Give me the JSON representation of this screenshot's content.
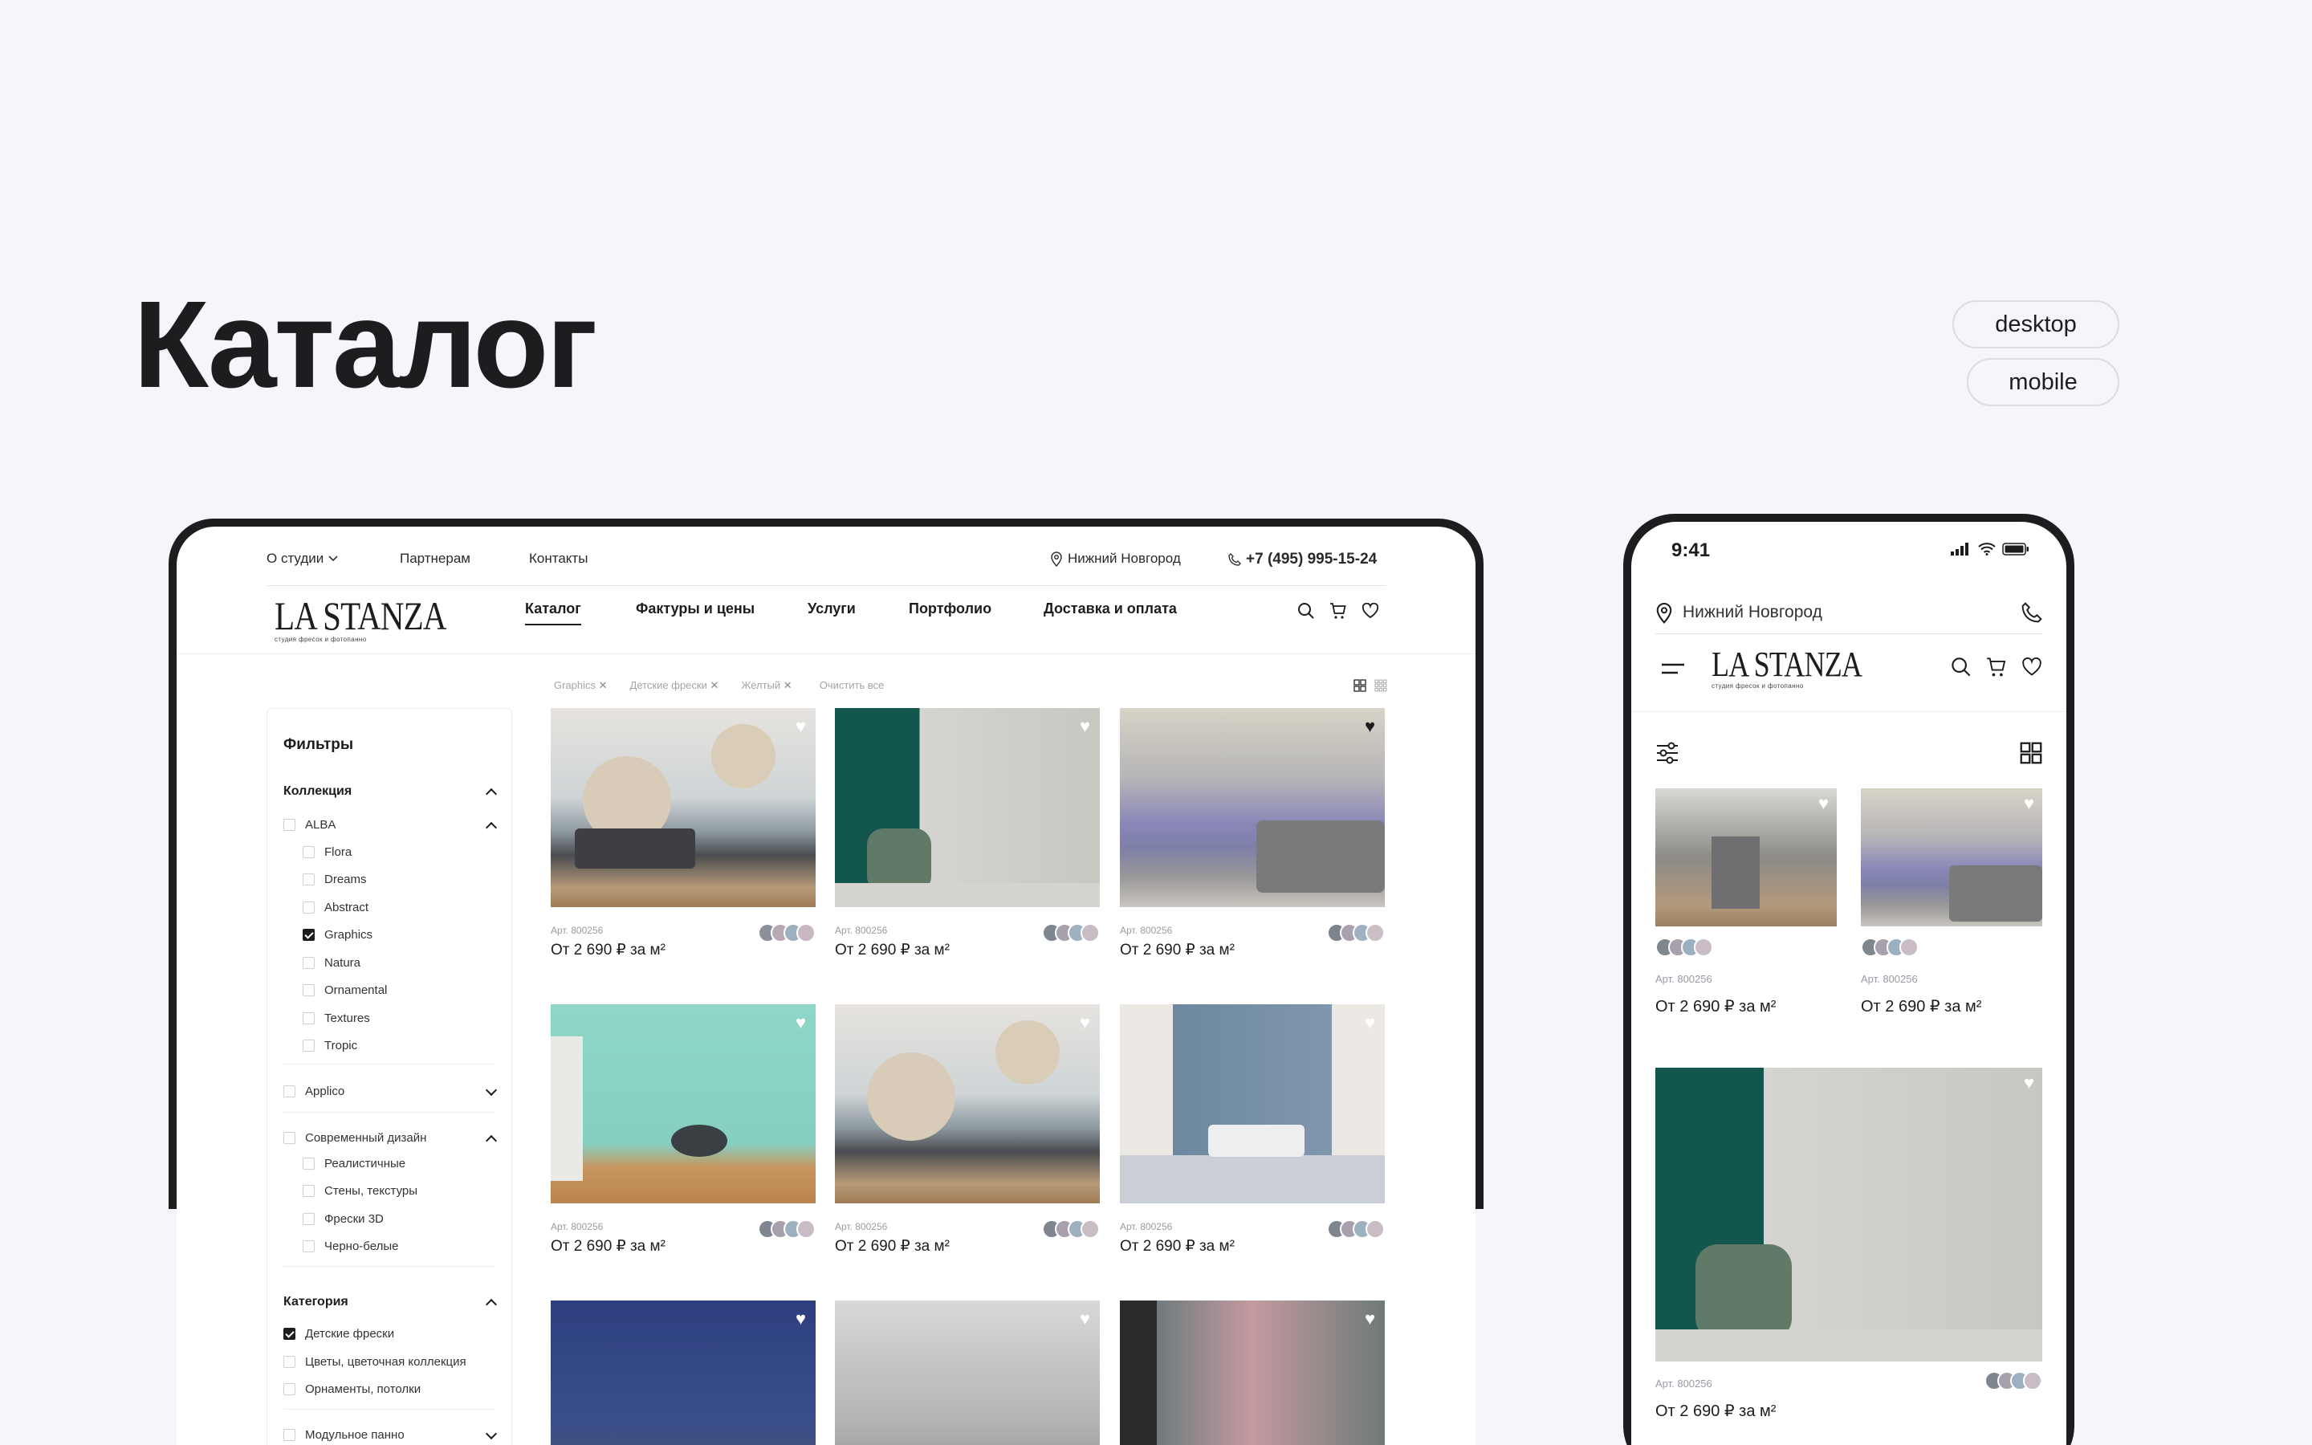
{
  "page": {
    "title": "Каталог"
  },
  "views": {
    "desktop": "desktop",
    "mobile": "mobile"
  },
  "colors": {
    "accent": "#1d1d1f",
    "background": "#f5f6fa",
    "muted": "#9a9aa2"
  },
  "desktop": {
    "topbar": {
      "about": "О студии",
      "partners": "Партнерам",
      "contacts": "Контакты",
      "city": "Нижний Новгород",
      "phone": "+7 (495) 995-15-24"
    },
    "brand": {
      "name": "LA STANZA",
      "tagline": "студия фресок и фотопанно"
    },
    "nav": [
      "Каталог",
      "Фактуры и цены",
      "Услуги",
      "Портфолио",
      "Доставка и оплата"
    ],
    "icons": [
      "search-icon",
      "cart-icon",
      "heart-icon"
    ],
    "tags": [
      "Graphics",
      "Детские фрески",
      "Желтый"
    ],
    "clear_all": "Очистить все",
    "filters": {
      "title": "Фильтры",
      "collection_title": "Коллекция",
      "alba": "ALBA",
      "alba_items": [
        "Flora",
        "Dreams",
        "Abstract",
        "Graphics",
        "Natura",
        "Ornamental",
        "Textures",
        "Tropic"
      ],
      "applico": "Applico",
      "modern": "Современный дизайн",
      "modern_items": [
        "Реалистичные",
        "Стены, текстуры",
        "Фрески 3D",
        "Черно-белые"
      ],
      "category_title": "Категория",
      "category_items": [
        "Детские фрески",
        "Цветы, цветочная коллекция",
        "Орнаменты, потолки"
      ],
      "modular": "Модульное панно"
    },
    "products": [
      {
        "art": "Арт. 800256",
        "price": "От 2 690 ₽ за м²"
      },
      {
        "art": "Арт. 800256",
        "price": "От 2 690 ₽ за м²"
      },
      {
        "art": "Арт. 800256",
        "price": "От 2 690 ₽ за м²"
      },
      {
        "art": "Арт. 800256",
        "price": "От 2 690 ₽ за м²"
      },
      {
        "art": "Арт. 800256",
        "price": "От 2 690 ₽ за м²"
      },
      {
        "art": "Арт. 800256",
        "price": "От 2 690 ₽ за м²"
      }
    ]
  },
  "mobile": {
    "time": "9:41",
    "city": "Нижний Новгород",
    "brand": {
      "name": "LA STANZA",
      "tagline": "студия фресок и фотопанно"
    },
    "products": [
      {
        "art": "Арт. 800256",
        "price": "От 2 690 ₽ за м²"
      },
      {
        "art": "Арт. 800256",
        "price": "От 2 690 ₽ за м²"
      },
      {
        "art": "Арт. 800256",
        "price": "От 2 690 ₽ за м²"
      }
    ]
  }
}
